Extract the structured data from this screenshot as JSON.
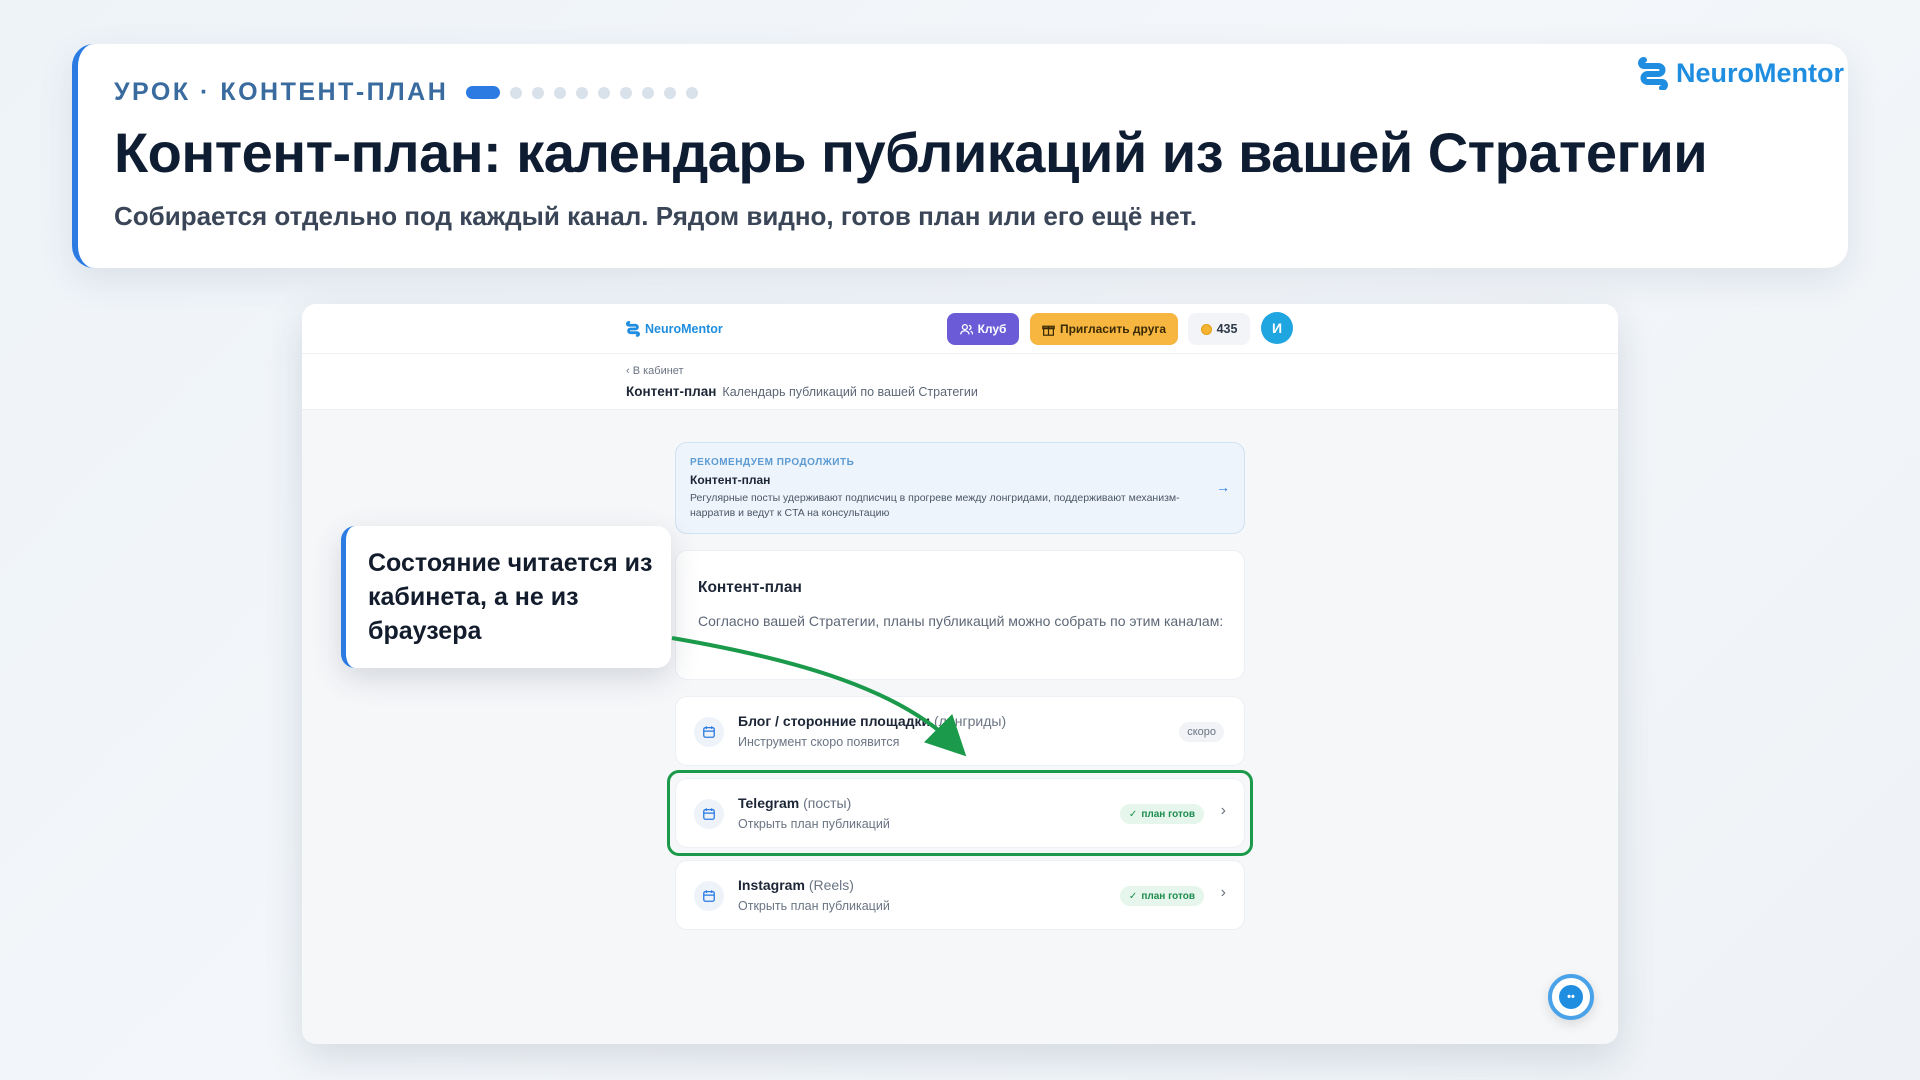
{
  "lesson": {
    "eyebrow": "УРОК · КОНТЕНТ-ПЛАН",
    "progress": {
      "current": 1,
      "total": 10
    },
    "title": "Контент-план: календарь публикаций из вашей Стратегии",
    "subtitle": "Собирается отдельно под каждый канал. Рядом видно, готов план или его ещё нет."
  },
  "brand": {
    "name": "NeuroMentor",
    "color": "#1f8de0"
  },
  "app": {
    "brand_name": "NeuroMentor",
    "club_label": "Клуб",
    "invite_label": "Пригласить друга",
    "coins": "435",
    "avatar_initial": "И",
    "back_label": "‹ В кабинет",
    "page_title": "Контент-план",
    "page_desc": "Календарь публикаций по вашей Стратегии",
    "recommend": {
      "eyebrow": "РЕКОМЕНДУЕМ ПРОДОЛЖИТЬ",
      "title": "Контент-план",
      "text": "Регулярные посты удерживают подписчиц в прогреве между лонгридами, поддерживают механизм-нарратив и ведут к CTA на консультацию",
      "arrow": "→"
    },
    "info": {
      "title": "Контент-план",
      "text": "Согласно вашей Стратегии, планы публикаций можно собрать по этим каналам:"
    },
    "channels": [
      {
        "name": "Блог / сторонние площадки",
        "qualifier": "(лонгриды)",
        "sub": "Инструмент скоро появится",
        "badge": "скоро",
        "status": "soon"
      },
      {
        "name": "Telegram",
        "qualifier": "(посты)",
        "sub": "Открыть план публикаций",
        "badge": "план готов",
        "status": "ready"
      },
      {
        "name": "Instagram",
        "qualifier": "(Reels)",
        "sub": "Открыть план публикаций",
        "badge": "план готов",
        "status": "ready"
      }
    ]
  },
  "callout": {
    "text": "Состояние читается из кабинета, а не из браузера"
  },
  "colors": {
    "accent": "#2b7be3",
    "highlight": "#1c9a4b",
    "club": "#6b5bd6",
    "invite": "#f7b640"
  }
}
